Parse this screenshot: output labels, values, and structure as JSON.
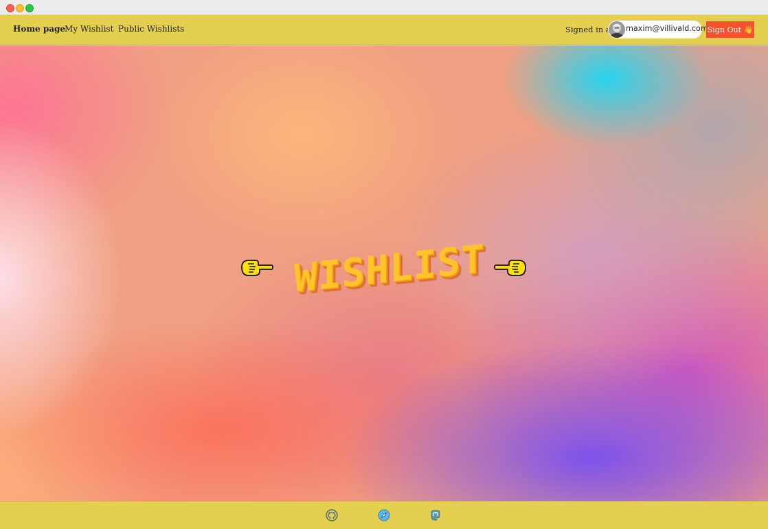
{
  "nav": {
    "links": [
      {
        "label": "Home page",
        "active": true
      },
      {
        "label": "My Wishlist",
        "active": false
      },
      {
        "label": "Public Wishlists",
        "active": false
      }
    ],
    "signed_in_label": "Signed in as",
    "user_email": "maxim@villivald.com",
    "sign_out_label": "Sign Out 👋"
  },
  "hero": {
    "title": "WISHLIST",
    "left_icon": "backhand-pointing-left-icon",
    "right_icon": "backhand-pointing-right-icon"
  },
  "footer": {
    "icons": [
      "github-icon",
      "safari-compass-icon",
      "mastodon-icon"
    ]
  },
  "colors": {
    "nav_background": "#e4cf50",
    "sign_out_background": "#f4512c",
    "logo_fill": "#ffc42a"
  }
}
